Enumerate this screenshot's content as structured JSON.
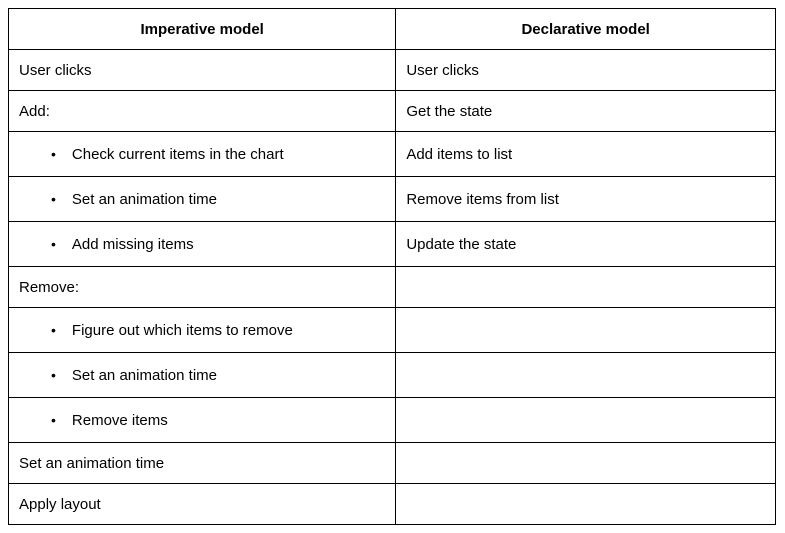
{
  "headers": {
    "left": "Imperative model",
    "right": "Declarative model"
  },
  "rows": [
    {
      "left": {
        "text": "User clicks",
        "bullet": false
      },
      "right": {
        "text": "User clicks",
        "bullet": false
      }
    },
    {
      "left": {
        "text": "Add:",
        "bullet": false
      },
      "right": {
        "text": "Get the state",
        "bullet": false
      }
    },
    {
      "left": {
        "text": "Check current items in the chart",
        "bullet": true
      },
      "right": {
        "text": "Add items to list",
        "bullet": false
      }
    },
    {
      "left": {
        "text": "Set an animation time",
        "bullet": true
      },
      "right": {
        "text": "Remove items from list",
        "bullet": false
      }
    },
    {
      "left": {
        "text": "Add missing items",
        "bullet": true
      },
      "right": {
        "text": "Update the state",
        "bullet": false
      }
    },
    {
      "left": {
        "text": "Remove:",
        "bullet": false
      },
      "right": {
        "text": "",
        "bullet": false
      }
    },
    {
      "left": {
        "text": "Figure out which items to remove",
        "bullet": true
      },
      "right": {
        "text": "",
        "bullet": false
      }
    },
    {
      "left": {
        "text": "Set an animation time",
        "bullet": true
      },
      "right": {
        "text": "",
        "bullet": false
      }
    },
    {
      "left": {
        "text": "Remove items",
        "bullet": true
      },
      "right": {
        "text": "",
        "bullet": false
      }
    },
    {
      "left": {
        "text": "Set an animation time",
        "bullet": false
      },
      "right": {
        "text": "",
        "bullet": false
      }
    },
    {
      "left": {
        "text": "Apply layout",
        "bullet": false
      },
      "right": {
        "text": "",
        "bullet": false
      }
    }
  ]
}
